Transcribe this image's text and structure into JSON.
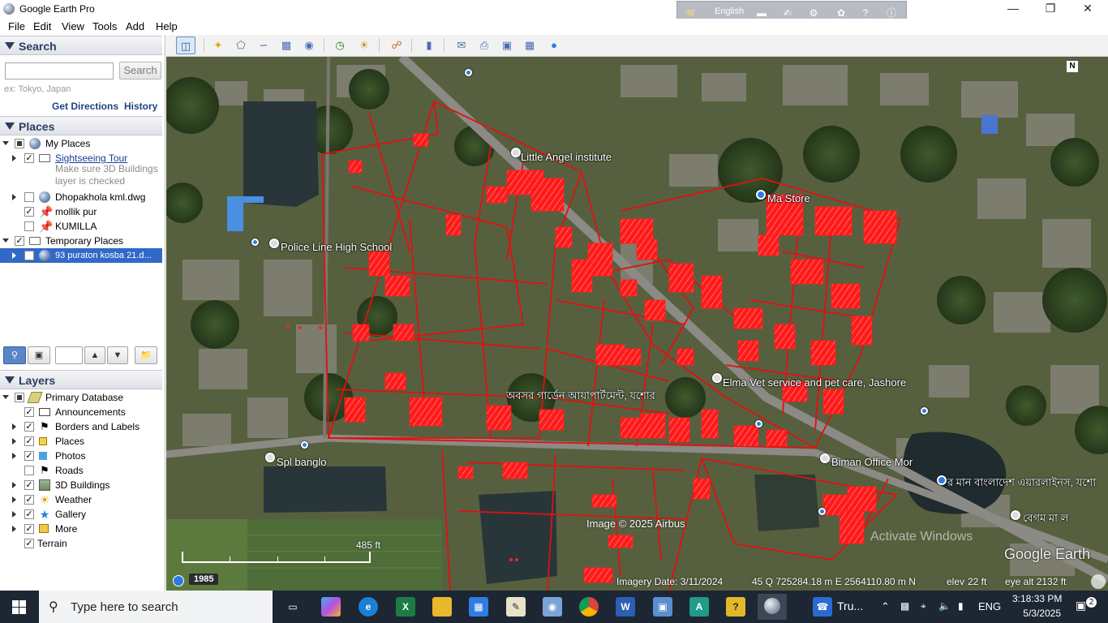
{
  "window": {
    "title": "Google Earth Pro"
  },
  "langbar": {
    "language": "English"
  },
  "menu": [
    "File",
    "Edit",
    "View",
    "Tools",
    "Add",
    "Help"
  ],
  "search": {
    "header": "Search",
    "placeholder": "",
    "button": "Search",
    "hint": "ex: Tokyo, Japan",
    "get_directions": "Get Directions",
    "history": "History"
  },
  "places": {
    "header": "Places",
    "items": [
      {
        "label": "My Places"
      },
      {
        "label": "Sightseeing Tour",
        "note1": "Make sure 3D Buildings",
        "note2": "layer is checked"
      },
      {
        "label": "Dhopakhola kml.dwg"
      },
      {
        "label": "mollik pur"
      },
      {
        "label": "KUMILLA"
      },
      {
        "label": "Temporary Places"
      },
      {
        "label": "93 puraton kosba 21.d..."
      }
    ]
  },
  "layers": {
    "header": "Layers",
    "items": [
      {
        "label": "Primary Database"
      },
      {
        "label": "Announcements"
      },
      {
        "label": "Borders and Labels"
      },
      {
        "label": "Places"
      },
      {
        "label": "Photos"
      },
      {
        "label": "Roads"
      },
      {
        "label": "3D Buildings"
      },
      {
        "label": "Weather"
      },
      {
        "label": "Gallery"
      },
      {
        "label": "More"
      },
      {
        "label": "Terrain"
      }
    ]
  },
  "map": {
    "labels": {
      "little_angel": "Little Angel institute",
      "ma_store": "Ma Store",
      "police_line": "Police Line High School",
      "elma": "Elma Vet service and pet care, Jashore",
      "abashar": "অবসর গার্ডেন আয়াপার্টমেন্ট, যশোর",
      "biman_mor": "Biman Office Mor",
      "biman_bd": "র মান বাংলাদেশ এয়ারলাইনস, যশো",
      "begum": "বেগম মা ল",
      "spl": "Spl banglo"
    },
    "compass": "N",
    "copyright": "Image © 2025 Airbus",
    "watermark": "Google Earth",
    "activate": "Activate Windows",
    "scale": "485 ft",
    "historical_year": "1985",
    "status": {
      "imagery_date": "Imagery Date: 3/11/2024",
      "coords": "45 Q 725284.18 m E 2564110.80 m N",
      "elev_label": "elev",
      "elev": "22 ft",
      "eye_alt": "eye alt  2132 ft"
    }
  },
  "taskbar": {
    "search_placeholder": "Type here to search",
    "app_label": "Tru...",
    "lang": "ENG",
    "time": "3:18:33 PM",
    "date": "5/3/2025",
    "notifications": "2"
  }
}
